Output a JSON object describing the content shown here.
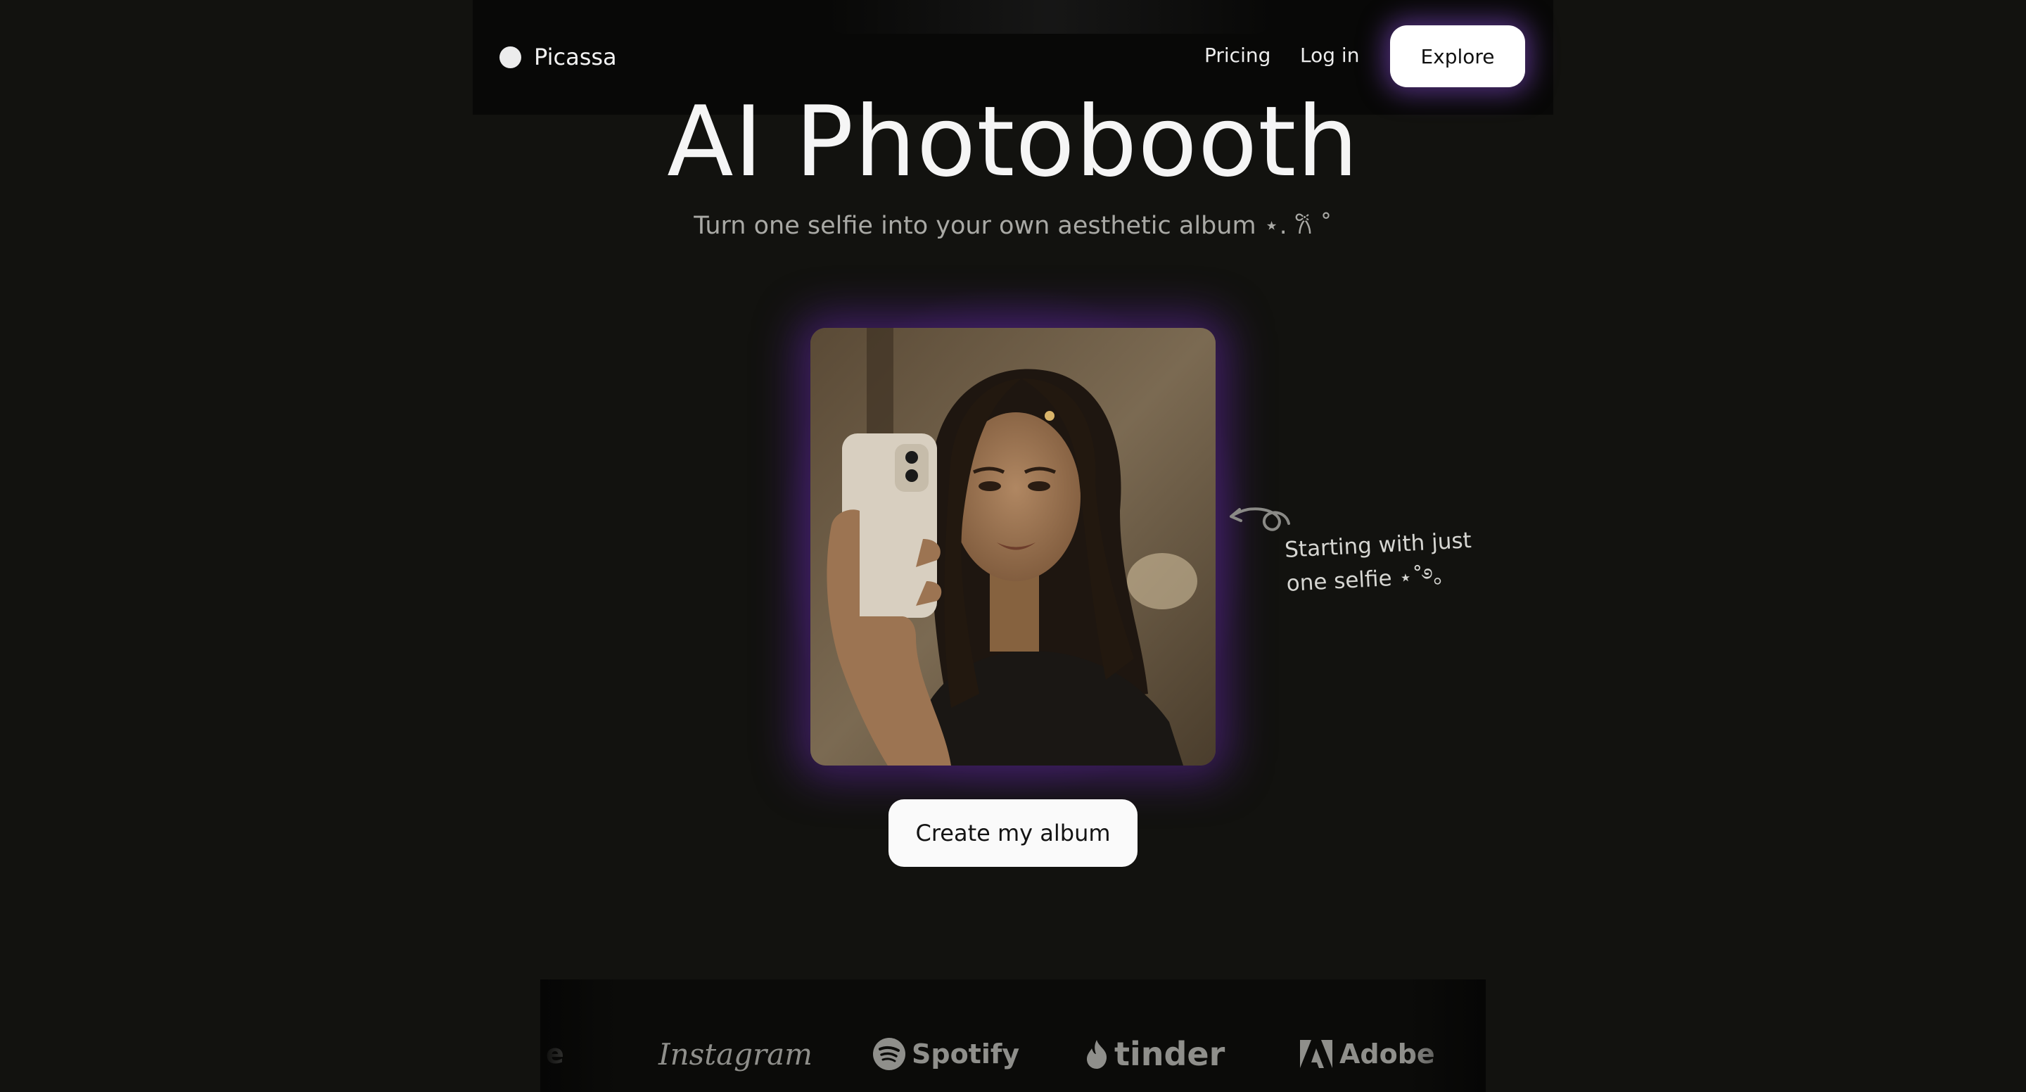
{
  "nav": {
    "brand": "Picassa",
    "links": [
      "Pricing",
      "Log in"
    ],
    "cta": "Explore"
  },
  "hero": {
    "title": "AI Photobooth",
    "subtitle": "Turn one selfie into your own aesthetic album ⋆. 𐙚 ˚"
  },
  "annotation": {
    "line1": "Starting with just",
    "line2": "one selfie ⋆˚࿔。"
  },
  "cta": "Create my album",
  "logos": {
    "partial": "e",
    "items": [
      "Instagram",
      "Spotify",
      "tinder",
      "Adobe"
    ]
  },
  "colors": {
    "background": "#12120f",
    "accent_glow": "#6e32be",
    "button": "#ffffff"
  }
}
